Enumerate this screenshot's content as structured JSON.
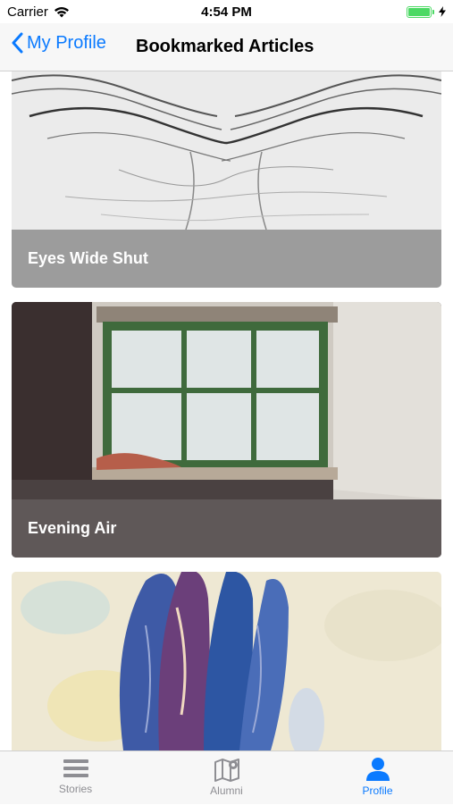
{
  "status_bar": {
    "carrier": "Carrier",
    "time": "4:54 PM"
  },
  "nav": {
    "back_label": "My Profile",
    "title": "Bookmarked Articles"
  },
  "articles": [
    {
      "title": "Eyes Wide Shut",
      "icon": "wrinkled-face-sketch"
    },
    {
      "title": "Evening Air",
      "icon": "window-photo"
    },
    {
      "title": "",
      "icon": "watercolor-painting"
    }
  ],
  "tabs": [
    {
      "label": "Stories",
      "icon": "list-icon",
      "active": false
    },
    {
      "label": "Alumni",
      "icon": "map-icon",
      "active": false
    },
    {
      "label": "Profile",
      "icon": "person-icon",
      "active": true
    }
  ],
  "colors": {
    "accent": "#0a7aff",
    "inactive": "#8e8e93",
    "battery": "#4cd964"
  }
}
